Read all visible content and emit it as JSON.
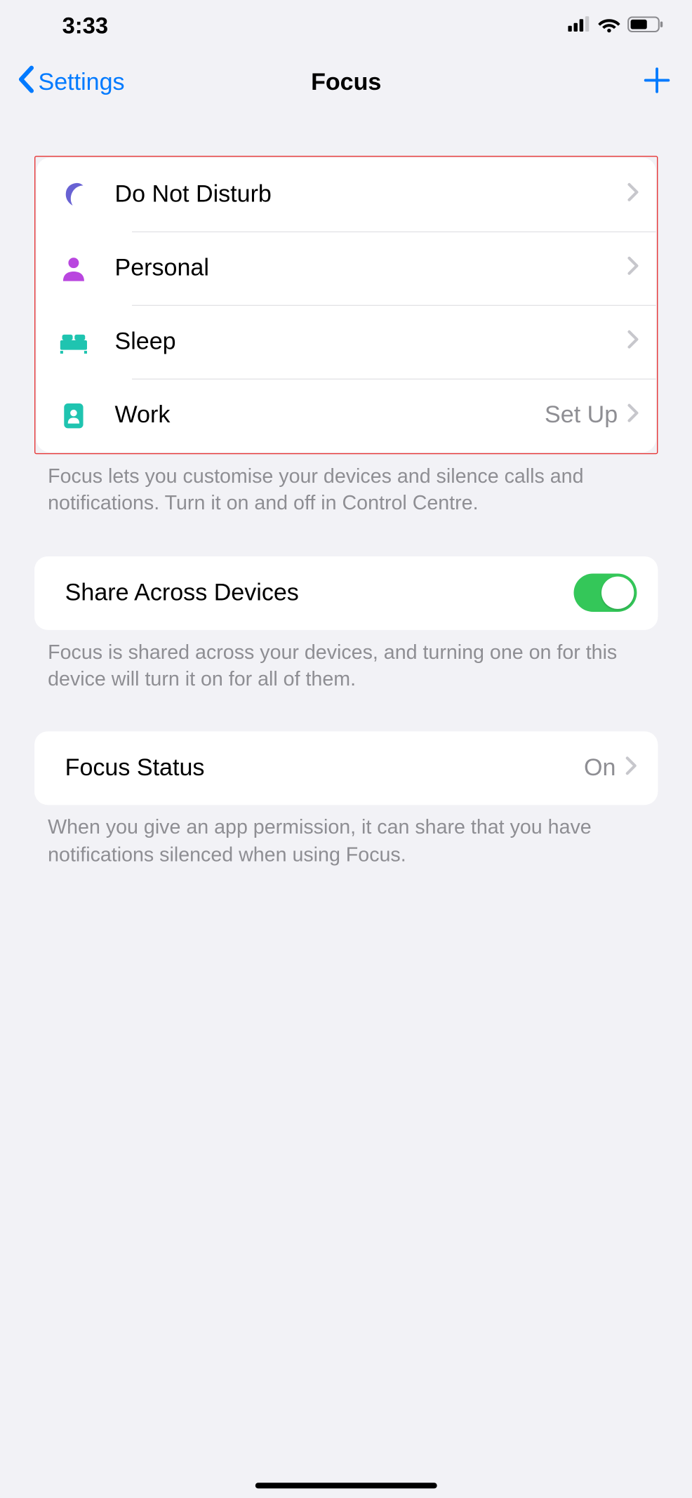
{
  "status_bar": {
    "time": "3:33"
  },
  "nav": {
    "back_label": "Settings",
    "title": "Focus"
  },
  "focus_list": {
    "items": [
      {
        "label": "Do Not Disturb",
        "value": ""
      },
      {
        "label": "Personal",
        "value": ""
      },
      {
        "label": "Sleep",
        "value": ""
      },
      {
        "label": "Work",
        "value": "Set Up"
      }
    ],
    "footer": "Focus lets you customise your devices and silence calls and notifications. Turn it on and off in Control Centre."
  },
  "share": {
    "label": "Share Across Devices",
    "enabled": true,
    "footer": "Focus is shared across your devices, and turning one on for this device will turn it on for all of them."
  },
  "status": {
    "label": "Focus Status",
    "value": "On",
    "footer": "When you give an app permission, it can share that you have notifications silenced when using Focus."
  }
}
